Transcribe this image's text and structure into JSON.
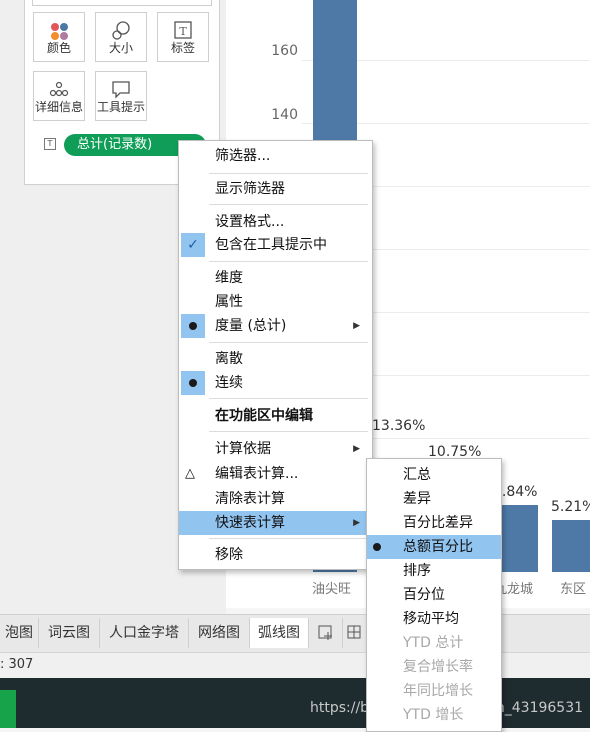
{
  "marks": {
    "buttons": [
      {
        "label": "颜色",
        "icon": "color-icon"
      },
      {
        "label": "大小",
        "icon": "size-icon"
      },
      {
        "label": "标签",
        "icon": "label-icon"
      },
      {
        "label": "详细信息",
        "icon": "detail-icon"
      },
      {
        "label": "工具提示",
        "icon": "tooltip-icon"
      }
    ],
    "pill_label": "总计(记录数)",
    "pill_type_icon": "T"
  },
  "chart_data": {
    "type": "bar",
    "yticks": [
      "160",
      "140"
    ],
    "categories": [
      "油尖旺",
      "九龙城",
      "东区"
    ],
    "visible_bar_labels": [
      "13.36%",
      "10.75%",
      "7.84%",
      "5.21%"
    ],
    "colors": {
      "bar": "#4e79a7"
    }
  },
  "context_menu": {
    "items": [
      {
        "label": "筛选器..."
      },
      {
        "label": "显示筛选器"
      },
      {
        "label": "设置格式..."
      },
      {
        "label": "包含在工具提示中",
        "checked": true
      },
      {
        "label": "维度"
      },
      {
        "label": "属性"
      },
      {
        "label": "度量 (总计)",
        "selected": true,
        "submenu": true
      },
      {
        "label": "离散"
      },
      {
        "label": "连续",
        "selected": true
      },
      {
        "label": "在功能区中编辑"
      },
      {
        "label": "计算依据",
        "submenu": true
      },
      {
        "label": "编辑表计算...",
        "icon": "delta-icon"
      },
      {
        "label": "清除表计算"
      },
      {
        "label": "快速表计算",
        "submenu": true,
        "highlighted": true
      },
      {
        "label": "移除"
      }
    ]
  },
  "quick_calc_menu": {
    "items": [
      {
        "label": "汇总"
      },
      {
        "label": "差异"
      },
      {
        "label": "百分比差异"
      },
      {
        "label": "总额百分比",
        "selected": true
      },
      {
        "label": "排序"
      },
      {
        "label": "百分位"
      },
      {
        "label": "移动平均"
      },
      {
        "label": "YTD 总计",
        "disabled": true
      },
      {
        "label": "复合增长率",
        "disabled": true
      },
      {
        "label": "年同比增长",
        "disabled": true
      },
      {
        "label": "YTD 增长",
        "disabled": true
      }
    ]
  },
  "tabs": [
    "泡图",
    "词云图",
    "人口金字塔",
    "网络图",
    "弧线图"
  ],
  "status_text": ": 307",
  "watermark": "https://blog.csdn.net/weixin_43196531",
  "colors": {
    "accent_green": "#0f9d58",
    "menu_highlight": "#92c4f0"
  }
}
